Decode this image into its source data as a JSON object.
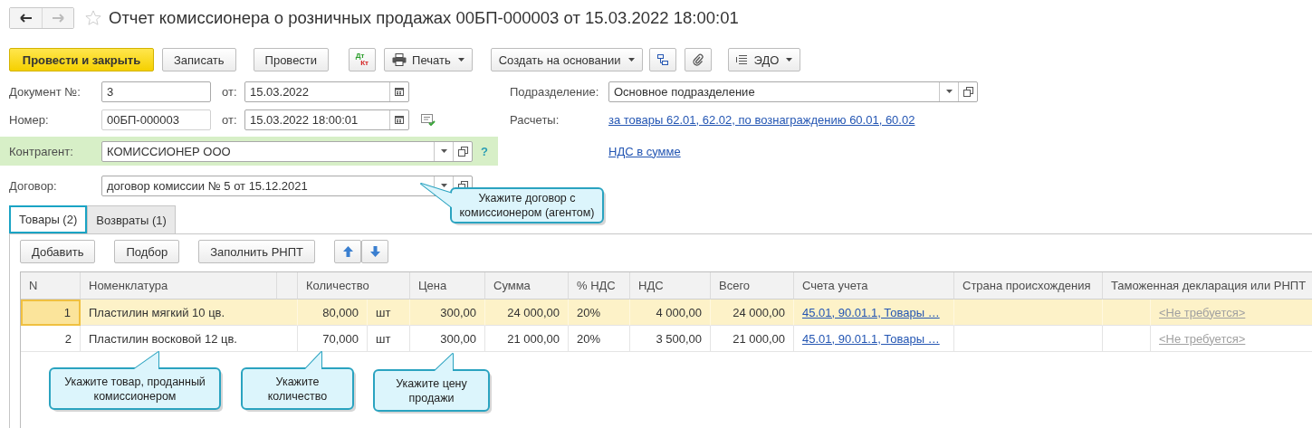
{
  "window": {
    "title": "Отчет комиссионера о розничных продажах 00БП-000003 от 15.03.2022 18:00:01"
  },
  "toolbar": {
    "primary": "Провести и закрыть",
    "buttons": [
      "Записать",
      "Провести"
    ],
    "dtkt": {
      "top": "Дт",
      "bottom": "Кт"
    },
    "print": "Печать",
    "create": "Создать на основании",
    "edo": "ЭДО"
  },
  "form": {
    "doc_number": {
      "label": "Документ №:",
      "value": "3",
      "date_label": "от:",
      "date": "15.03.2022"
    },
    "number": {
      "label": "Номер:",
      "value": "00БП-000003",
      "date_label": "от:",
      "date": "15.03.2022 18:00:01"
    },
    "counterparty": {
      "label": "Контрагент:",
      "value": "КОМИССИОНЕР ООО",
      "help": "?",
      "highlighted": true
    },
    "contract": {
      "label": "Договор:",
      "value": "договор комиссии № 5 от 15.12.2021"
    },
    "department": {
      "label": "Подразделение:",
      "value": "Основное подразделение"
    },
    "settlements": {
      "label": "Расчеты:",
      "link": "за товары 62.01, 62.02, по вознаграждению 60.01, 60.02"
    },
    "vat_link": "НДС в сумме"
  },
  "tabs": [
    {
      "label": "Товары (2)",
      "selected": true
    },
    {
      "label": "Возвраты (1)",
      "selected": false
    }
  ],
  "table_toolbar": [
    "Добавить",
    "Подбор",
    "Заполнить РНПТ"
  ],
  "table": {
    "columns": [
      "N",
      "Номенклатура",
      "Количество",
      "Цена",
      "Сумма",
      "% НДС",
      "НДС",
      "Всего",
      "Счета учета",
      "Страна происхождения",
      "Таможенная декларация или РНПТ"
    ],
    "rows": [
      {
        "n": "1",
        "item": "Пластилин мягкий 10 цв.",
        "qty": "80,000",
        "unit": "шт",
        "price": "300,00",
        "sum": "24 000,00",
        "vat_rate": "20%",
        "vat": "4 000,00",
        "total": "24 000,00",
        "accounts": "45.01, 90.01.1, Товары …",
        "declaration": "<Не требуется>",
        "selected": true
      },
      {
        "n": "2",
        "item": "Пластилин восковой 12 цв.",
        "qty": "70,000",
        "unit": "шт",
        "price": "300,00",
        "sum": "21 000,00",
        "vat_rate": "20%",
        "vat": "3 500,00",
        "total": "21 000,00",
        "accounts": "45.01, 90.01.1, Товары …",
        "declaration": "<Не требуется>",
        "selected": false
      }
    ]
  },
  "callouts": [
    {
      "text": "Укажите договор с комиссионером (агентом)"
    },
    {
      "text": "Укажите товар, проданный комиссионером"
    },
    {
      "text": "Укажите количество"
    },
    {
      "text": "Укажите цену продажи"
    }
  ]
}
